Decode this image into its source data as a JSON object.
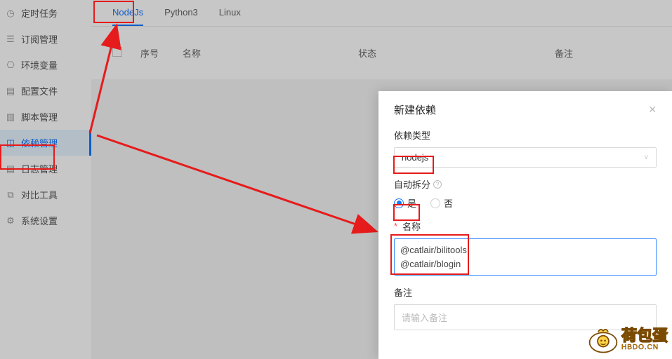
{
  "sidebar": {
    "items": [
      {
        "label": "定时任务"
      },
      {
        "label": "订阅管理"
      },
      {
        "label": "环境变量"
      },
      {
        "label": "配置文件"
      },
      {
        "label": "脚本管理"
      },
      {
        "label": "依赖管理"
      },
      {
        "label": "日志管理"
      },
      {
        "label": "对比工具"
      },
      {
        "label": "系统设置"
      }
    ],
    "active_index": 5
  },
  "tabs": {
    "items": [
      "NodeJs",
      "Python3",
      "Linux"
    ],
    "active_index": 0
  },
  "table": {
    "headers": {
      "seq": "序号",
      "name": "名称",
      "status": "状态",
      "note": "备注"
    }
  },
  "modal": {
    "title": "新建依赖",
    "close": "✕",
    "fields": {
      "type_label": "依赖类型",
      "type_value": "nodejs",
      "split_label": "自动拆分",
      "split_yes": "是",
      "split_no": "否",
      "split_value": true,
      "name_label": "名称",
      "name_value": "@catlair/bilitools\n@catlair/blogin",
      "note_label": "备注",
      "note_placeholder": "请输入备注"
    }
  },
  "watermark": {
    "text": "荷包蛋",
    "sub": "HBDO.CN"
  },
  "colors": {
    "primary": "#1677ff",
    "red": "#e61b1b",
    "orange": "#ff9900"
  }
}
